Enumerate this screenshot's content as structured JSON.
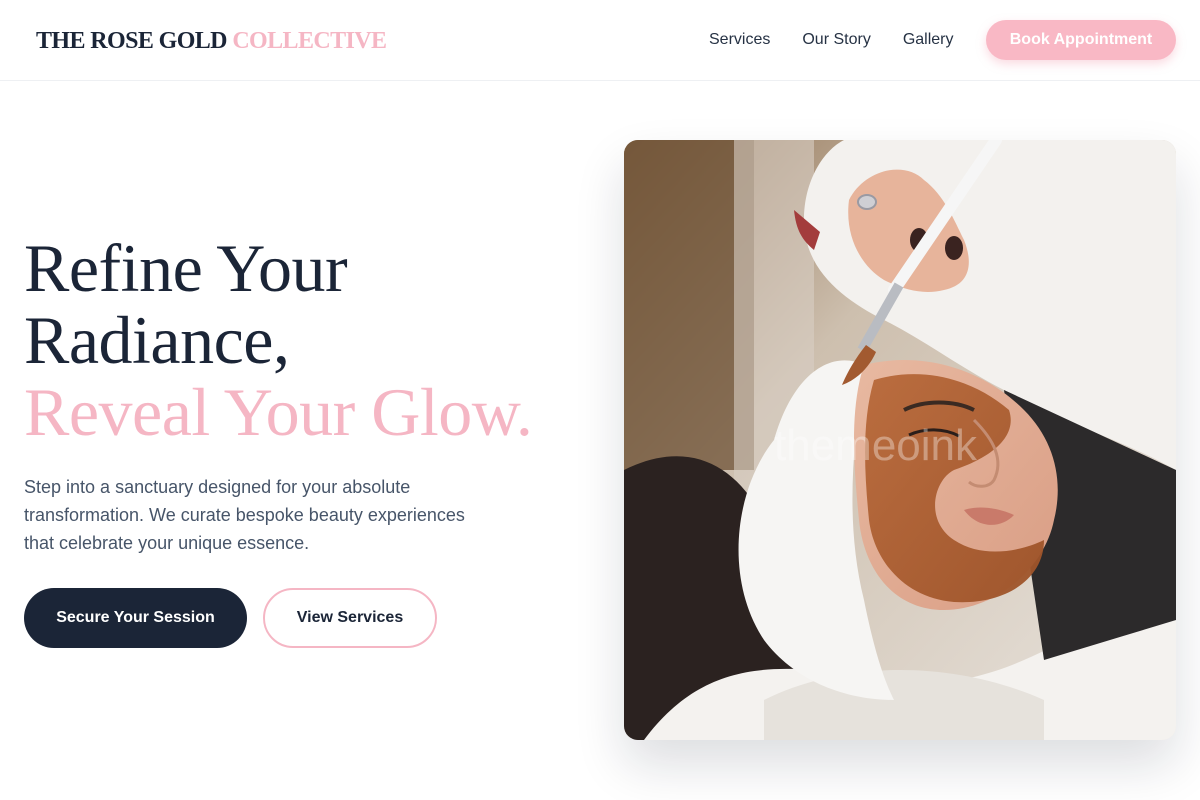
{
  "header": {
    "logo_part1": "THE ROSE GOLD",
    "logo_part2": "COLLECTIVE",
    "nav": [
      "Services",
      "Our Story",
      "Gallery"
    ],
    "cta_label": "Book Appointment"
  },
  "hero": {
    "headline_line1": "Refine Your",
    "headline_line2": "Radiance,",
    "headline_line3": "Reveal Your Glow.",
    "subcopy": "Step into a sanctuary designed for your absolute transformation. We curate bespoke beauty experiences that celebrate your unique essence.",
    "primary_button": "Secure Your Session",
    "secondary_button": "View Services",
    "image_watermark": "themeoink"
  },
  "colors": {
    "navy": "#1b2537",
    "rose": "#f5b6c4",
    "body_text": "#475569"
  }
}
